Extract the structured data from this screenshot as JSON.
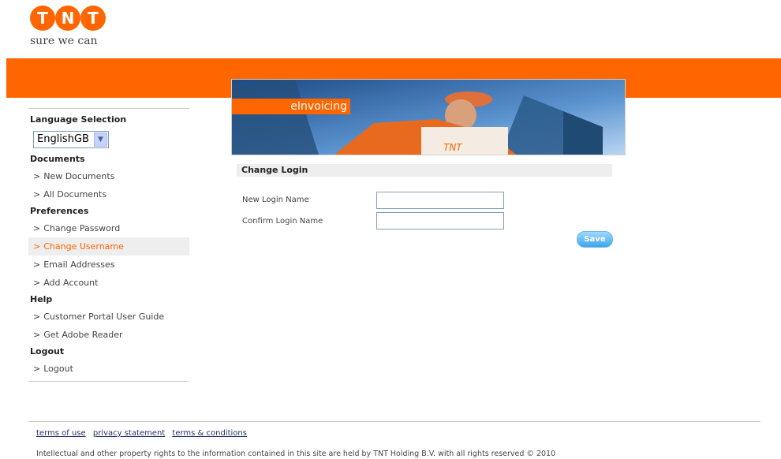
{
  "brand": {
    "logo": "TNT",
    "tagline": "sure we can"
  },
  "hero": {
    "tab_label": "eInvoicing"
  },
  "sidebar": {
    "language_title": "Language Selection",
    "language_value": "EnglishGB",
    "documents_title": "Documents",
    "documents": [
      "New Documents",
      "All Documents"
    ],
    "preferences_title": "Preferences",
    "preferences": [
      "Change Password",
      "Change Username",
      "Email Addresses",
      "Add Account"
    ],
    "help_title": "Help",
    "help": [
      "Customer Portal User Guide",
      "Get Adobe Reader"
    ],
    "logout_title": "Logout",
    "logout": [
      "Logout"
    ],
    "arrow": ">"
  },
  "form": {
    "title": "Change Login",
    "new_login_label": "New Login Name",
    "confirm_login_label": "Confirm Login Name",
    "new_login_value": "",
    "confirm_login_value": "",
    "save_label": "Save"
  },
  "footer": {
    "links": [
      "terms of use",
      "privacy statement",
      "terms & conditions"
    ],
    "copyright": "Intellectual and other property rights to the information contained in this site are held by TNT Holding B.V. with all rights reserved © 2010"
  },
  "colors": {
    "brand_orange": "#ff6600",
    "active_text": "#ff6600",
    "button_blue": "#3fa6e8"
  }
}
